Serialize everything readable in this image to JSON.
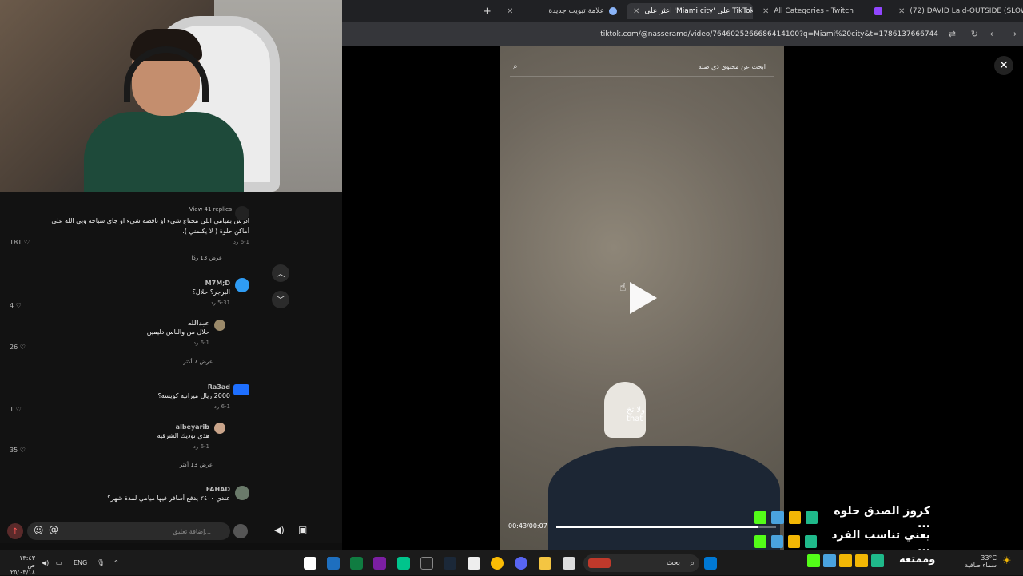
{
  "browser": {
    "tabs": [
      {
        "title": "(72) DAVID Laid-OUTSIDE (SLOWED)",
        "icon": "youtube-icon",
        "color": "#ff0000"
      },
      {
        "title": "All Categories - Twitch",
        "icon": "twitch-icon",
        "color": "#9146ff"
      },
      {
        "title": "اعثر على 'Miami city' على TikTok",
        "icon": "tiktok-icon",
        "color": "#25f4ee"
      },
      {
        "title": "علامة تبويب جديدة",
        "icon": "chrome-icon",
        "color": "#8ab4f8"
      }
    ],
    "new_tab": "+",
    "url": "tiktok.com/@nasseramd/video/7646025266686414100?q=Miami%20city&t=1786137666744"
  },
  "comments": [
    {
      "text": "ادرس بميامي اللي محتاج شيء او ناقصه شيء او جاي سياحة وبي الله على أماكن حلوة ( لا يكلمني ).",
      "meta": "6-1   رد",
      "likes": "181",
      "replies": "View 41 replies"
    },
    {
      "user": "",
      "text": "",
      "meta": "",
      "likes": "",
      "replies": "عرض 13 ردًا"
    },
    {
      "user": "M7M;D",
      "text": "البرجر؟ حلال؟",
      "meta": "5-31   رد",
      "likes": "4",
      "replies": ""
    },
    {
      "user": "عبدالله",
      "text": "حلال من والناس دليمين",
      "meta": "6-1   رد",
      "likes": "26",
      "replies": "عرض 7 أكثر"
    },
    {
      "user": "Ra3ad",
      "text": "2000 ريال ميزانيه كويسه؟",
      "meta": "6-1   رد",
      "likes": "1",
      "replies": ""
    },
    {
      "user": "albeyarib",
      "text": "هذي نوديك الشرقيه",
      "meta": "6-1   رد",
      "likes": "35",
      "replies": "عرض 13 أكثر"
    },
    {
      "user": "FAHAD",
      "text": "عندي ٢٤٠٠ يدفع أسافر فيها ميامي لمدة شهر؟",
      "meta": "",
      "likes": "",
      "replies": ""
    }
  ],
  "comment_input": {
    "placeholder": "إضافة تعليق..."
  },
  "video": {
    "search_placeholder": "ابحث عن محتوى ذي صلة",
    "subtitle_ar": "ولا تخ",
    "subtitle_en": "that",
    "time": "00:43/00:07",
    "progress": 0.92
  },
  "overlay": {
    "line1": "كروز الصدق حلوه ...",
    "line2": "يعني تناسب الفرد ...",
    "line3": "وممتعه"
  },
  "taskbar": {
    "search": "بحث",
    "lang": "ENG",
    "time": "١٣:٤٣ ص",
    "date": "٢٥/٠٣/١٨",
    "weather_temp": "33°C",
    "weather_desc": "سماء صافية"
  }
}
